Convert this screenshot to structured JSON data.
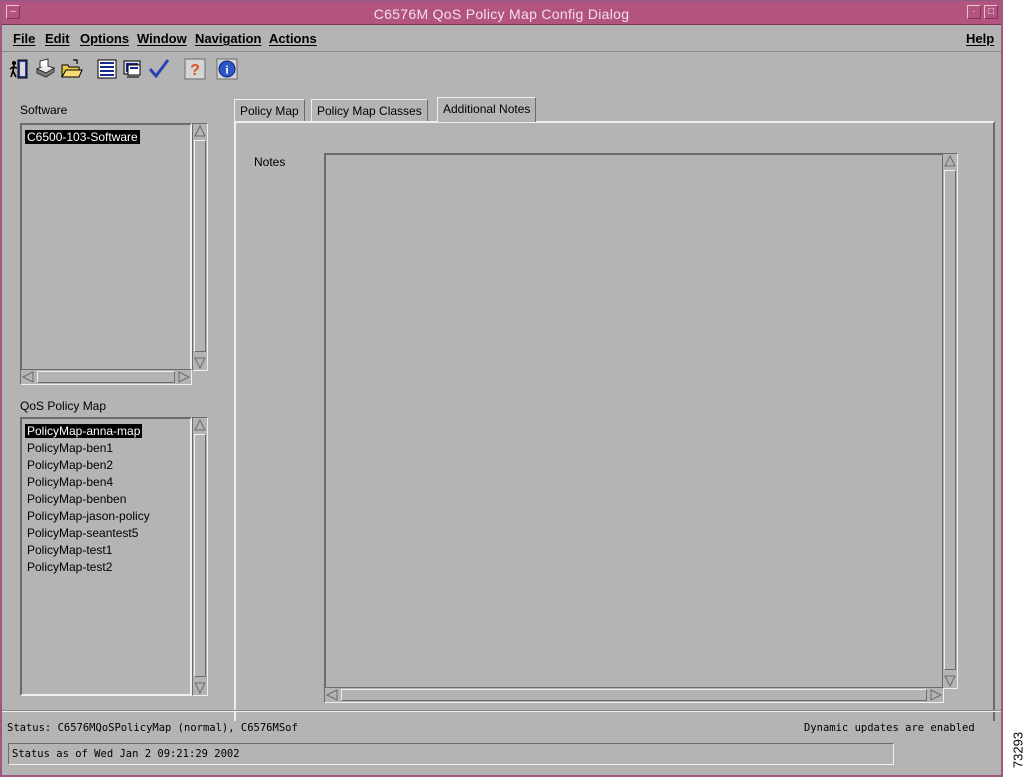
{
  "window": {
    "title": "C6576M QoS Policy Map Config Dialog"
  },
  "menubar": {
    "items": [
      "File",
      "Edit",
      "Options",
      "Window",
      "Navigation",
      "Actions"
    ],
    "help": "Help"
  },
  "toolbar": {
    "icons": [
      "exit-icon",
      "print-icon",
      "open-folder-icon",
      "list-icon",
      "screen-icon",
      "check-icon",
      "help-icon",
      "info-icon"
    ]
  },
  "software": {
    "label": "Software",
    "items": [
      "C6500-103-Software"
    ],
    "selected_index": 0
  },
  "policy_map": {
    "label": "QoS Policy Map",
    "items": [
      "PolicyMap-anna-map",
      "PolicyMap-ben1",
      "PolicyMap-ben2",
      "PolicyMap-ben4",
      "PolicyMap-benben",
      "PolicyMap-jason-policy",
      "PolicyMap-seantest5",
      "PolicyMap-test1",
      "PolicyMap-test2"
    ],
    "selected_index": 0
  },
  "tabs": {
    "items": [
      "Policy Map",
      "Policy Map Classes",
      "Additional Notes"
    ],
    "active_index": 2
  },
  "notes": {
    "label": "Notes",
    "value": ""
  },
  "status": {
    "text": "Status: C6576MQoSPolicyMap (normal), C6576MSof",
    "updates": "Dynamic updates are enabled",
    "as_of": "Status as of Wed Jan  2 09:21:29 2002"
  },
  "figure_id": "73293",
  "colors": {
    "titlebar": "#b2547e",
    "window_bg": "#b4b4b4",
    "selection_bg": "#000000"
  }
}
